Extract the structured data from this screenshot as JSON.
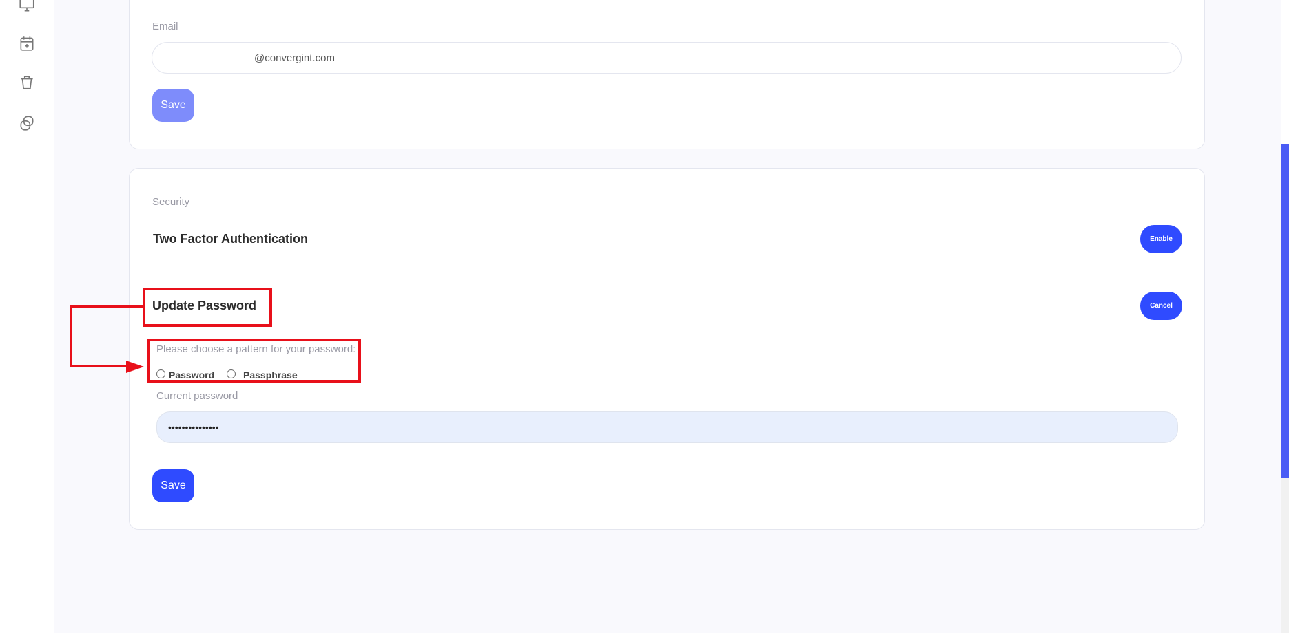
{
  "sidebar": {
    "icons": [
      "monitor-icon",
      "calendar-add-icon",
      "trash-icon",
      "copy-icon"
    ]
  },
  "email_card": {
    "label": "Email",
    "email_value": "@convergint.com",
    "save_label": "Save"
  },
  "security_card": {
    "section_label": "Security",
    "two_factor": {
      "title": "Two Factor Authentication",
      "button_label": "Enable"
    },
    "update_password": {
      "title": "Update Password",
      "button_label": "Cancel",
      "pattern_prompt": "Please choose a pattern for your password:",
      "options": [
        "Password",
        "Passphrase"
      ],
      "current_password_label": "Current password",
      "current_password_value": "•••••••••••••••",
      "save_label": "Save"
    }
  },
  "colors": {
    "primary": "#2f4bff",
    "primary_disabled": "#7e8cfb",
    "annotation": "#e8101a",
    "input_filled_bg": "#e8effd"
  }
}
